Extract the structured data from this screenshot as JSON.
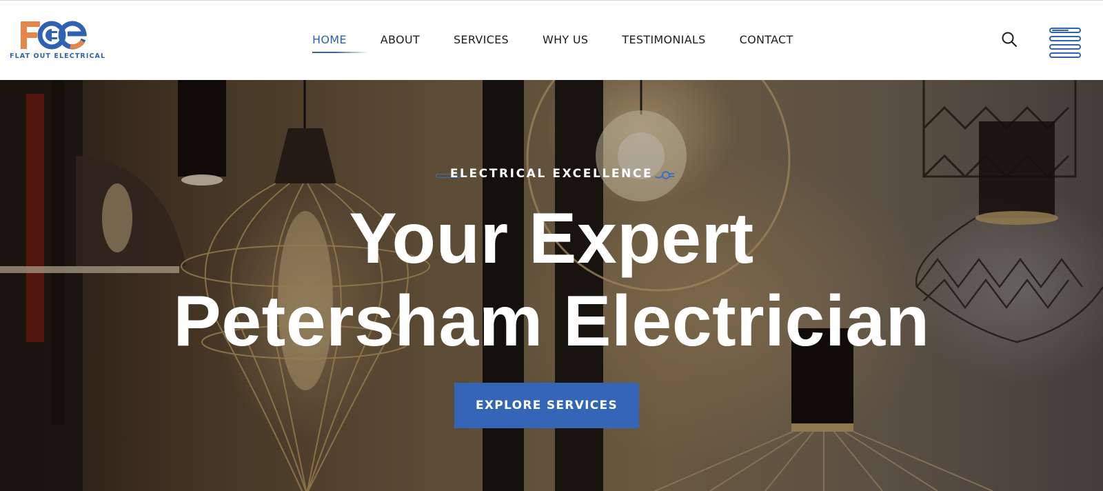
{
  "brand": {
    "logo_letters": "FOE",
    "name": "FLAT OUT ELECTRICAL",
    "colors": {
      "orange": "#e5874a",
      "blue": "#2f62b2"
    }
  },
  "nav": {
    "items": [
      {
        "label": "HOME",
        "active": true
      },
      {
        "label": "ABOUT",
        "active": false
      },
      {
        "label": "SERVICES",
        "active": false
      },
      {
        "label": "WHY US",
        "active": false
      },
      {
        "label": "TESTIMONIALS",
        "active": false
      },
      {
        "label": "CONTACT",
        "active": false
      }
    ],
    "active_color": "#2f62b2"
  },
  "header_actions": {
    "search_icon": "search-icon",
    "menu_icon": "hamburger-menu-icon"
  },
  "hero": {
    "eyebrow": "ELECTRICAL EXCELLENCE",
    "headline_line1": "Your Expert",
    "headline_line2": "Petersham Electrician",
    "cta_label": "EXPLORE SERVICES",
    "cta_color": "#3465b7"
  }
}
